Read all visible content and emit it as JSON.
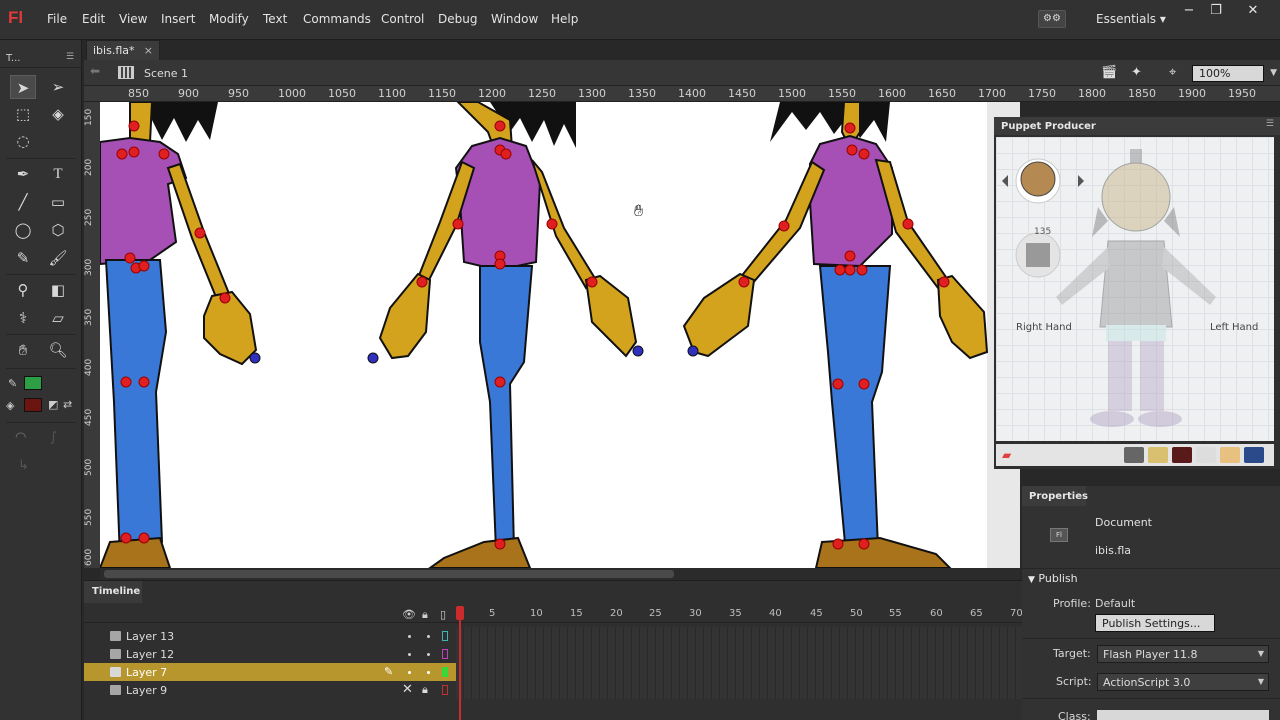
{
  "app": {
    "logo": "Fl"
  },
  "menubar": {
    "items": [
      "File",
      "Edit",
      "View",
      "Insert",
      "Modify",
      "Text",
      "Commands",
      "Control",
      "Debug",
      "Window",
      "Help"
    ],
    "workspace": "Essentials"
  },
  "window_controls": {
    "minimize": "−",
    "restore": "❐",
    "close": "✕"
  },
  "tools": {
    "title": "T..."
  },
  "document": {
    "tab_label": "ibis.fla*",
    "close": "×"
  },
  "editbar": {
    "scene": "Scene 1",
    "zoom": "100%"
  },
  "ruler": {
    "top": [
      "850",
      "900",
      "950",
      "1000",
      "1050",
      "1100",
      "1150",
      "1200",
      "1250",
      "1300",
      "1350",
      "1400",
      "1450",
      "1500",
      "1550",
      "1600",
      "1650",
      "1700",
      "1750",
      "1800",
      "1850",
      "1900",
      "1950"
    ],
    "left": [
      "150",
      "200",
      "250",
      "300",
      "350",
      "400",
      "450",
      "500",
      "550",
      "600"
    ]
  },
  "timeline": {
    "tab": "Timeline",
    "frame_numbers": [
      "1",
      "5",
      "10",
      "15",
      "20",
      "25",
      "30",
      "35",
      "40",
      "45",
      "50",
      "55",
      "60",
      "65",
      "70"
    ],
    "layers": [
      {
        "name": "Layer 13",
        "color": "#3fb5b5",
        "selected": false
      },
      {
        "name": "Layer 12",
        "color": "#c040c0",
        "selected": false
      },
      {
        "name": "Layer 7",
        "color": "#36d936",
        "selected": true
      },
      {
        "name": "Layer 9",
        "color": "#c03030",
        "selected": false
      }
    ]
  },
  "puppet": {
    "title": "Puppet Producer",
    "number": "135",
    "label_right": "Right Hand",
    "label_left": "Left Hand"
  },
  "properties": {
    "tab": "Properties",
    "doc_type": "Document",
    "doc_icon": "Fl",
    "doc_name": "ibis.fla",
    "publish_header": "Publish",
    "profile_label": "Profile:",
    "profile_value": "Default",
    "publish_settings": "Publish Settings...",
    "target_label": "Target:",
    "target_value": "Flash Player 11.8",
    "script_label": "Script:",
    "script_value": "ActionScript 3.0",
    "class_label": "Class:"
  },
  "colors": {
    "stroke_swatch": "#2e9e46",
    "fill_swatch": "#6b1410",
    "skin": "#d4a31e",
    "shirt": "#a64fb5",
    "jeans": "#3a78d8",
    "joint": "#e02020",
    "handle": "#3030c0"
  }
}
